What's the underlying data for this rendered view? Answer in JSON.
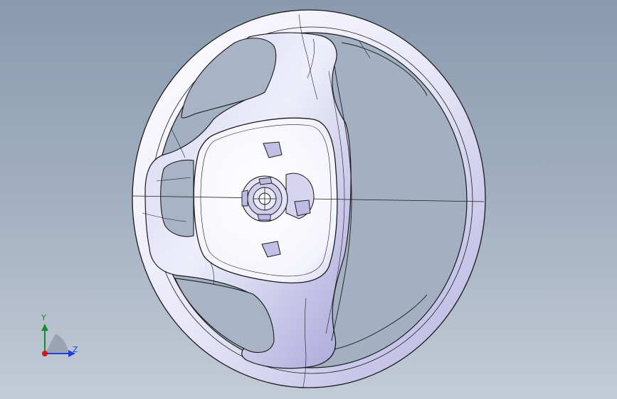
{
  "viewport": {
    "background_top": "#8a9aae",
    "background_bottom": "#c3cbd6"
  },
  "model": {
    "icon": "steering-wheel-model",
    "surface_color": "#f2f2fb",
    "shade_color": "#b8b6e2",
    "edge_color": "#1a1a1a"
  },
  "triad": {
    "y_label": "Y",
    "z_label": "Z",
    "y_color": "#1b8a2e",
    "z_color": "#1f3fd6",
    "x_color": "#d01818"
  }
}
